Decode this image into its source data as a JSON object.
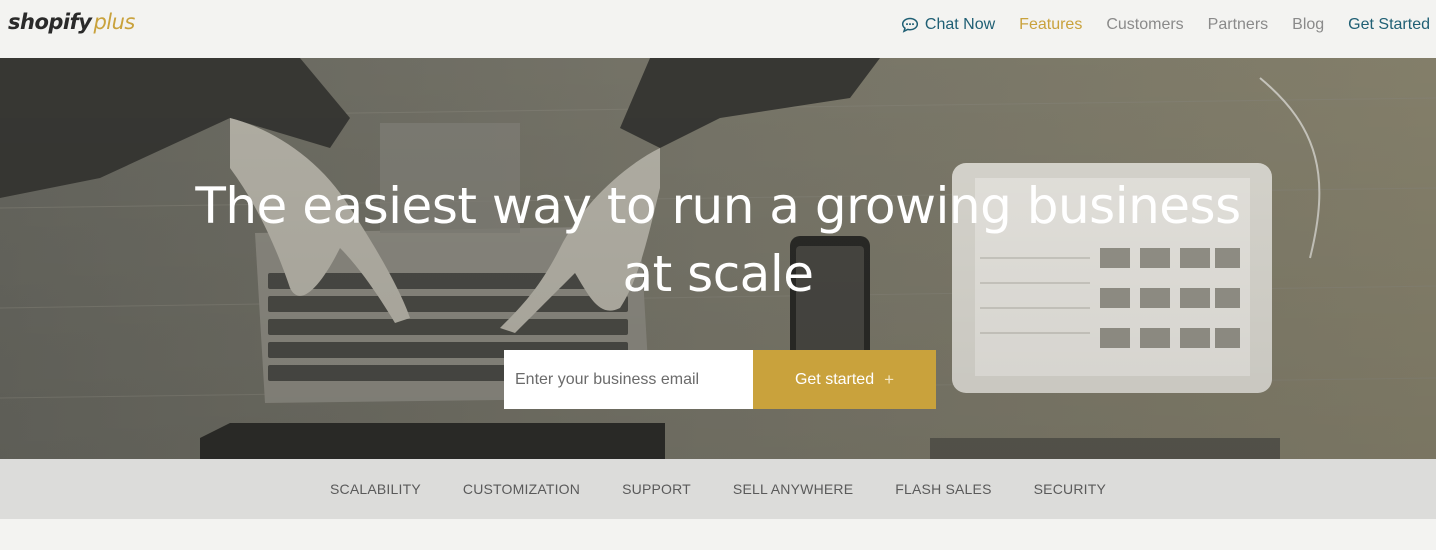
{
  "brand": {
    "name": "shopify",
    "suffix": "plus"
  },
  "nav": {
    "chat": "Chat Now",
    "items": [
      "Features",
      "Customers",
      "Partners",
      "Blog"
    ],
    "cta": "Get Started"
  },
  "hero": {
    "title_line1": "The easiest way to run a growing business",
    "title_line2": "at scale",
    "email_placeholder": "Enter your business email",
    "button_label": "Get started",
    "button_icon": "+"
  },
  "subnav": [
    "SCALABILITY",
    "CUSTOMIZATION",
    "SUPPORT",
    "SELL ANYWHERE",
    "FLASH SALES",
    "SECURITY"
  ],
  "colors": {
    "accent": "#c9a23c",
    "link": "#1f5f74",
    "hero_tint": "#767468"
  }
}
